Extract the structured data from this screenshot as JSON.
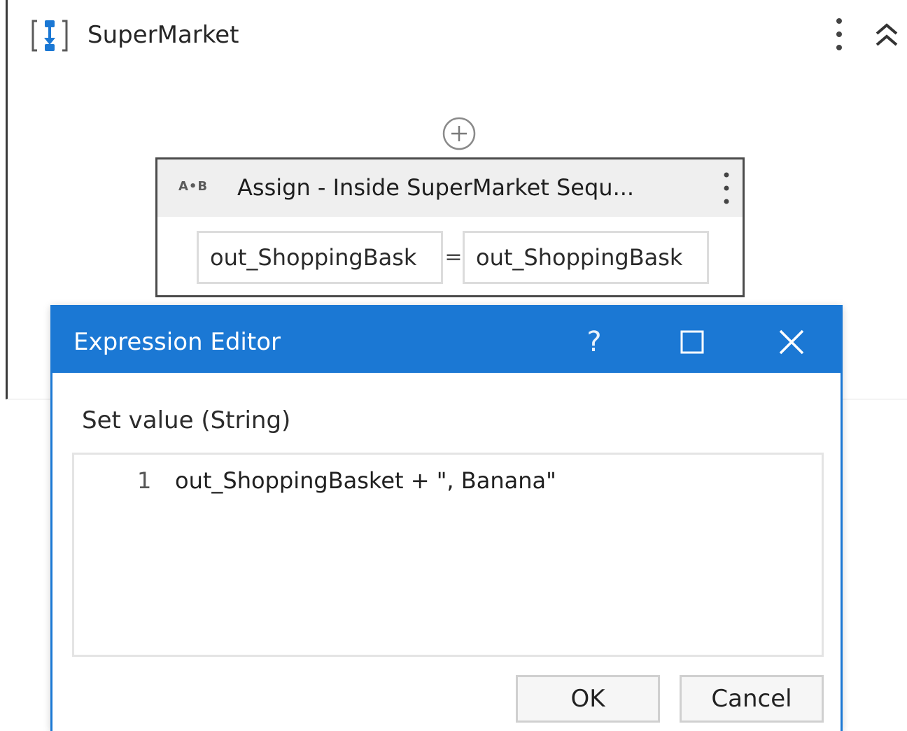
{
  "sequence": {
    "title": "SuperMarket",
    "icon": "sequence-icon",
    "menu_icon": "vertical-dots-icon",
    "collapse_icon": "double-chevron-up-icon",
    "add_icon": "plus-circle-icon"
  },
  "assign": {
    "icon_text": "A•B",
    "title": "Assign - Inside SuperMarket Sequ...",
    "menu_icon": "vertical-dots-icon",
    "left_value": "out_ShoppingBask",
    "operator": "=",
    "right_value": "out_ShoppingBask"
  },
  "dialog": {
    "title": "Expression Editor",
    "help_label": "?",
    "maximize_icon": "maximize-icon",
    "close_icon": "close-icon",
    "field_label": "Set value (String)",
    "line_number": "1",
    "expression": "out_ShoppingBasket + \", Banana\"",
    "ok_label": "OK",
    "cancel_label": "Cancel"
  },
  "colors": {
    "accent": "#1b78d4",
    "header_bg": "#efefef"
  }
}
